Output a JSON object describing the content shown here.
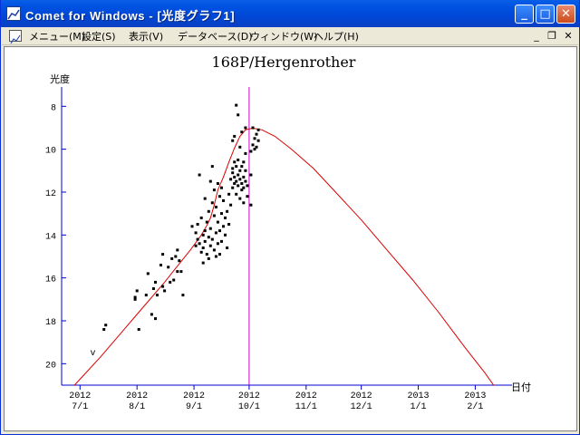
{
  "window": {
    "title": "Comet for Windows - [光度グラフ1]",
    "buttons": {
      "minimize": "_",
      "maximize": "□",
      "close": "✕"
    }
  },
  "menu": {
    "items": [
      "メニュー(M)",
      "設定(S)",
      "表示(V)",
      "データベース(D)",
      "ウィンドウ(W)",
      "ヘルプ(H)"
    ],
    "mdi_buttons": [
      "_",
      "❐",
      "✕"
    ]
  },
  "chart_data": {
    "type": "scatter",
    "title": "168P/Hergenrother",
    "ylabel": "光度",
    "xlabel": "日付",
    "y_reversed": true,
    "ylim": [
      21,
      7.1
    ],
    "xlim": [
      "2012-06-21",
      "2013-02-21"
    ],
    "y_ticks": [
      8,
      10,
      12,
      14,
      16,
      18,
      20
    ],
    "x_ticks": [
      {
        "date": "2012-07-01",
        "year": "2012",
        "md": "7/1"
      },
      {
        "date": "2012-08-01",
        "year": "2012",
        "md": "8/1"
      },
      {
        "date": "2012-09-01",
        "year": "2012",
        "md": "9/1"
      },
      {
        "date": "2012-10-01",
        "year": "2012",
        "md": "10/1"
      },
      {
        "date": "2012-11-01",
        "year": "2012",
        "md": "11/1"
      },
      {
        "date": "2012-12-01",
        "year": "2012",
        "md": "12/1"
      },
      {
        "date": "2013-01-01",
        "year": "2013",
        "md": "1/1"
      },
      {
        "date": "2013-02-01",
        "year": "2013",
        "md": "2/1"
      }
    ],
    "current_date": "2012-10-01",
    "marker": {
      "date": "2012-07-08",
      "mag": 19.6,
      "text": "v"
    },
    "colors": {
      "axis": "#0000cc",
      "curve": "#dd0000",
      "current": "#cc00cc",
      "points": "#000000"
    },
    "curve": [
      [
        "2012-06-28",
        21.0
      ],
      [
        "2012-07-05",
        20.35
      ],
      [
        "2012-07-12",
        19.7
      ],
      [
        "2012-07-19",
        19.0
      ],
      [
        "2012-07-26",
        18.3
      ],
      [
        "2012-08-02",
        17.6
      ],
      [
        "2012-08-09",
        16.9
      ],
      [
        "2012-08-16",
        16.2
      ],
      [
        "2012-08-23",
        15.45
      ],
      [
        "2012-08-30",
        14.7
      ],
      [
        "2012-09-05",
        14.0
      ],
      [
        "2012-09-08",
        13.55
      ],
      [
        "2012-09-10",
        13.2
      ],
      [
        "2012-09-12",
        12.6
      ],
      [
        "2012-09-14",
        11.9
      ],
      [
        "2012-09-17",
        11.3
      ],
      [
        "2012-09-20",
        10.6
      ],
      [
        "2012-09-23",
        9.95
      ],
      [
        "2012-09-26",
        9.4
      ],
      [
        "2012-09-29",
        9.1
      ],
      [
        "2012-10-03",
        9.02
      ],
      [
        "2012-10-08",
        9.1
      ],
      [
        "2012-10-15",
        9.4
      ],
      [
        "2012-10-24",
        10.0
      ],
      [
        "2012-11-05",
        10.9
      ],
      [
        "2012-11-17",
        12.0
      ],
      [
        "2012-12-01",
        13.3
      ],
      [
        "2012-12-15",
        14.7
      ],
      [
        "2012-12-29",
        16.1
      ],
      [
        "2013-01-12",
        17.6
      ],
      [
        "2013-01-26",
        19.2
      ],
      [
        "2013-02-06",
        20.4
      ],
      [
        "2013-02-11",
        21.0
      ]
    ],
    "points": [
      [
        "2012-07-14",
        18.4
      ],
      [
        "2012-07-15",
        18.2
      ],
      [
        "2012-07-31",
        17.0
      ],
      [
        "2012-07-31",
        16.9
      ],
      [
        "2012-08-01",
        16.6
      ],
      [
        "2012-08-02",
        18.4
      ],
      [
        "2012-08-06",
        16.8
      ],
      [
        "2012-08-07",
        15.8
      ],
      [
        "2012-08-09",
        17.7
      ],
      [
        "2012-08-10",
        16.5
      ],
      [
        "2012-08-11",
        16.2
      ],
      [
        "2012-08-11",
        17.9
      ],
      [
        "2012-08-12",
        16.8
      ],
      [
        "2012-08-14",
        15.4
      ],
      [
        "2012-08-15",
        14.9
      ],
      [
        "2012-08-15",
        16.4
      ],
      [
        "2012-08-16",
        16.6
      ],
      [
        "2012-08-18",
        15.5
      ],
      [
        "2012-08-19",
        16.2
      ],
      [
        "2012-08-20",
        15.1
      ],
      [
        "2012-08-21",
        16.1
      ],
      [
        "2012-08-22",
        15.0
      ],
      [
        "2012-08-23",
        15.7
      ],
      [
        "2012-08-23",
        14.7
      ],
      [
        "2012-08-24",
        15.2
      ],
      [
        "2012-08-25",
        15.7
      ],
      [
        "2012-08-26",
        16.8
      ],
      [
        "2012-08-31",
        13.6
      ],
      [
        "2012-09-02",
        13.9
      ],
      [
        "2012-09-02",
        14.5
      ],
      [
        "2012-09-03",
        14.2
      ],
      [
        "2012-09-03",
        13.5
      ],
      [
        "2012-09-04",
        14.4
      ],
      [
        "2012-09-04",
        11.2
      ],
      [
        "2012-09-05",
        13.2
      ],
      [
        "2012-09-05",
        14.8
      ],
      [
        "2012-09-06",
        14.0
      ],
      [
        "2012-09-06",
        14.6
      ],
      [
        "2012-09-06",
        15.3
      ],
      [
        "2012-09-07",
        13.8
      ],
      [
        "2012-09-07",
        14.3
      ],
      [
        "2012-09-07",
        12.3
      ],
      [
        "2012-09-08",
        14.9
      ],
      [
        "2012-09-08",
        13.4
      ],
      [
        "2012-09-09",
        14.1
      ],
      [
        "2012-09-09",
        12.9
      ],
      [
        "2012-09-09",
        15.1
      ],
      [
        "2012-09-10",
        14.5
      ],
      [
        "2012-09-10",
        13.7
      ],
      [
        "2012-09-10",
        11.5
      ],
      [
        "2012-09-11",
        12.5
      ],
      [
        "2012-09-11",
        10.8
      ],
      [
        "2012-09-11",
        14.2
      ],
      [
        "2012-09-12",
        13.1
      ],
      [
        "2012-09-12",
        11.9
      ],
      [
        "2012-09-12",
        14.7
      ],
      [
        "2012-09-13",
        13.9
      ],
      [
        "2012-09-13",
        12.7
      ],
      [
        "2012-09-13",
        15.0
      ],
      [
        "2012-09-14",
        13.4
      ],
      [
        "2012-09-14",
        11.6
      ],
      [
        "2012-09-14",
        14.4
      ],
      [
        "2012-09-15",
        12.2
      ],
      [
        "2012-09-15",
        13.8
      ],
      [
        "2012-09-15",
        14.9
      ],
      [
        "2012-09-16",
        13.0
      ],
      [
        "2012-09-16",
        14.3
      ],
      [
        "2012-09-16",
        11.8
      ],
      [
        "2012-09-17",
        13.6
      ],
      [
        "2012-09-17",
        12.4
      ],
      [
        "2012-09-18",
        14.0
      ],
      [
        "2012-09-18",
        13.2
      ],
      [
        "2012-09-19",
        12.9
      ],
      [
        "2012-09-19",
        14.6
      ],
      [
        "2012-09-20",
        12.1
      ],
      [
        "2012-09-20",
        13.5
      ],
      [
        "2012-09-21",
        11.4
      ],
      [
        "2012-09-21",
        12.6
      ],
      [
        "2012-09-22",
        11.1
      ],
      [
        "2012-09-22",
        10.9
      ],
      [
        "2012-09-22",
        9.6
      ],
      [
        "2012-09-22",
        11.8
      ],
      [
        "2012-09-23",
        11.3
      ],
      [
        "2012-09-23",
        11.6
      ],
      [
        "2012-09-23",
        9.4
      ],
      [
        "2012-09-23",
        10.6
      ],
      [
        "2012-09-24",
        7.95
      ],
      [
        "2012-09-24",
        10.8
      ],
      [
        "2012-09-24",
        11.5
      ],
      [
        "2012-09-24",
        12.1
      ],
      [
        "2012-09-25",
        8.4
      ],
      [
        "2012-09-25",
        11.2
      ],
      [
        "2012-09-25",
        11.7
      ],
      [
        "2012-09-25",
        10.5
      ],
      [
        "2012-09-26",
        11.4
      ],
      [
        "2012-09-26",
        11.0
      ],
      [
        "2012-09-26",
        12.3
      ],
      [
        "2012-09-26",
        9.9
      ],
      [
        "2012-09-27",
        11.6
      ],
      [
        "2012-09-27",
        10.8
      ],
      [
        "2012-09-27",
        11.9
      ],
      [
        "2012-09-27",
        9.2
      ],
      [
        "2012-09-28",
        11.3
      ],
      [
        "2012-09-28",
        12.5
      ],
      [
        "2012-09-28",
        10.6
      ],
      [
        "2012-09-28",
        11.8
      ],
      [
        "2012-09-29",
        11.0
      ],
      [
        "2012-09-29",
        9.0
      ],
      [
        "2012-09-29",
        11.5
      ],
      [
        "2012-09-29",
        10.2
      ],
      [
        "2012-09-30",
        11.7
      ],
      [
        "2012-09-30",
        12.2
      ],
      [
        "2012-10-02",
        11.2
      ],
      [
        "2012-10-02",
        10.1
      ],
      [
        "2012-10-02",
        12.6
      ],
      [
        "2012-10-03",
        9.8
      ],
      [
        "2012-10-03",
        9.0
      ],
      [
        "2012-10-04",
        9.5
      ],
      [
        "2012-10-04",
        10.0
      ],
      [
        "2012-10-05",
        9.3
      ],
      [
        "2012-10-05",
        9.9
      ],
      [
        "2012-10-06",
        9.1
      ],
      [
        "2012-10-06",
        9.6
      ]
    ]
  }
}
